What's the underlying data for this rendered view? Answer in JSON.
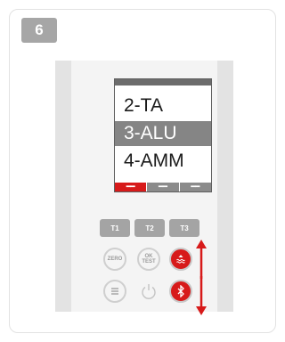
{
  "step_number": "6",
  "screen": {
    "menu_items": [
      "2-TA",
      "3-ALU",
      "4-AMM"
    ],
    "selected_index": 1,
    "soft_keys": [
      "━━",
      "━━",
      "━━"
    ]
  },
  "buttons": {
    "t1": "T1",
    "t2": "T2",
    "t3": "T3",
    "zero": "ZERO",
    "ok": "OK",
    "test": "TEST"
  },
  "icons": {
    "up_button": "waves-up-icon",
    "down_button": "bluetooth-icon",
    "menu": "menu-icon",
    "power": "power-icon",
    "up_arrow": "arrow-up-icon",
    "down_arrow": "arrow-down-icon"
  },
  "colors": {
    "accent_red": "#d71a1a",
    "badge_gray": "#a6a6a6",
    "device_gray": "#e3e3e3"
  }
}
